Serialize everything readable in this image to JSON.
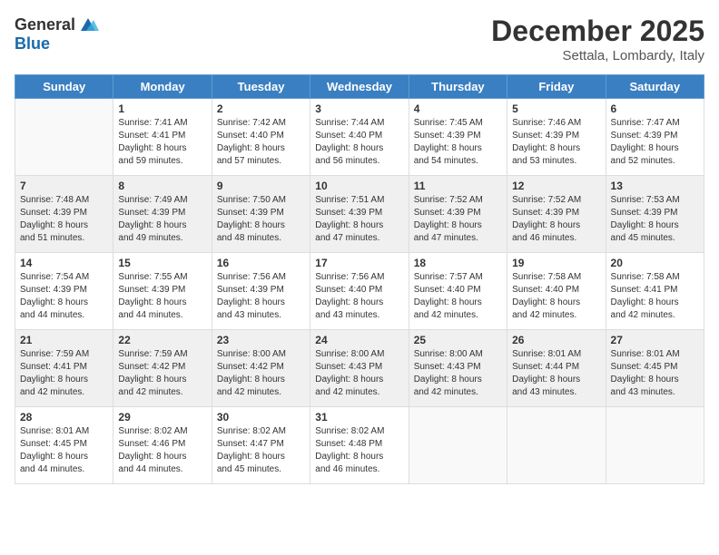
{
  "header": {
    "logo_general": "General",
    "logo_blue": "Blue",
    "month_title": "December 2025",
    "location": "Settala, Lombardy, Italy"
  },
  "weekdays": [
    "Sunday",
    "Monday",
    "Tuesday",
    "Wednesday",
    "Thursday",
    "Friday",
    "Saturday"
  ],
  "weeks": [
    [
      {
        "day": "",
        "info": ""
      },
      {
        "day": "1",
        "info": "Sunrise: 7:41 AM\nSunset: 4:41 PM\nDaylight: 8 hours\nand 59 minutes."
      },
      {
        "day": "2",
        "info": "Sunrise: 7:42 AM\nSunset: 4:40 PM\nDaylight: 8 hours\nand 57 minutes."
      },
      {
        "day": "3",
        "info": "Sunrise: 7:44 AM\nSunset: 4:40 PM\nDaylight: 8 hours\nand 56 minutes."
      },
      {
        "day": "4",
        "info": "Sunrise: 7:45 AM\nSunset: 4:39 PM\nDaylight: 8 hours\nand 54 minutes."
      },
      {
        "day": "5",
        "info": "Sunrise: 7:46 AM\nSunset: 4:39 PM\nDaylight: 8 hours\nand 53 minutes."
      },
      {
        "day": "6",
        "info": "Sunrise: 7:47 AM\nSunset: 4:39 PM\nDaylight: 8 hours\nand 52 minutes."
      }
    ],
    [
      {
        "day": "7",
        "info": "Sunrise: 7:48 AM\nSunset: 4:39 PM\nDaylight: 8 hours\nand 51 minutes."
      },
      {
        "day": "8",
        "info": "Sunrise: 7:49 AM\nSunset: 4:39 PM\nDaylight: 8 hours\nand 49 minutes."
      },
      {
        "day": "9",
        "info": "Sunrise: 7:50 AM\nSunset: 4:39 PM\nDaylight: 8 hours\nand 48 minutes."
      },
      {
        "day": "10",
        "info": "Sunrise: 7:51 AM\nSunset: 4:39 PM\nDaylight: 8 hours\nand 47 minutes."
      },
      {
        "day": "11",
        "info": "Sunrise: 7:52 AM\nSunset: 4:39 PM\nDaylight: 8 hours\nand 47 minutes."
      },
      {
        "day": "12",
        "info": "Sunrise: 7:52 AM\nSunset: 4:39 PM\nDaylight: 8 hours\nand 46 minutes."
      },
      {
        "day": "13",
        "info": "Sunrise: 7:53 AM\nSunset: 4:39 PM\nDaylight: 8 hours\nand 45 minutes."
      }
    ],
    [
      {
        "day": "14",
        "info": "Sunrise: 7:54 AM\nSunset: 4:39 PM\nDaylight: 8 hours\nand 44 minutes."
      },
      {
        "day": "15",
        "info": "Sunrise: 7:55 AM\nSunset: 4:39 PM\nDaylight: 8 hours\nand 44 minutes."
      },
      {
        "day": "16",
        "info": "Sunrise: 7:56 AM\nSunset: 4:39 PM\nDaylight: 8 hours\nand 43 minutes."
      },
      {
        "day": "17",
        "info": "Sunrise: 7:56 AM\nSunset: 4:40 PM\nDaylight: 8 hours\nand 43 minutes."
      },
      {
        "day": "18",
        "info": "Sunrise: 7:57 AM\nSunset: 4:40 PM\nDaylight: 8 hours\nand 42 minutes."
      },
      {
        "day": "19",
        "info": "Sunrise: 7:58 AM\nSunset: 4:40 PM\nDaylight: 8 hours\nand 42 minutes."
      },
      {
        "day": "20",
        "info": "Sunrise: 7:58 AM\nSunset: 4:41 PM\nDaylight: 8 hours\nand 42 minutes."
      }
    ],
    [
      {
        "day": "21",
        "info": "Sunrise: 7:59 AM\nSunset: 4:41 PM\nDaylight: 8 hours\nand 42 minutes."
      },
      {
        "day": "22",
        "info": "Sunrise: 7:59 AM\nSunset: 4:42 PM\nDaylight: 8 hours\nand 42 minutes."
      },
      {
        "day": "23",
        "info": "Sunrise: 8:00 AM\nSunset: 4:42 PM\nDaylight: 8 hours\nand 42 minutes."
      },
      {
        "day": "24",
        "info": "Sunrise: 8:00 AM\nSunset: 4:43 PM\nDaylight: 8 hours\nand 42 minutes."
      },
      {
        "day": "25",
        "info": "Sunrise: 8:00 AM\nSunset: 4:43 PM\nDaylight: 8 hours\nand 42 minutes."
      },
      {
        "day": "26",
        "info": "Sunrise: 8:01 AM\nSunset: 4:44 PM\nDaylight: 8 hours\nand 43 minutes."
      },
      {
        "day": "27",
        "info": "Sunrise: 8:01 AM\nSunset: 4:45 PM\nDaylight: 8 hours\nand 43 minutes."
      }
    ],
    [
      {
        "day": "28",
        "info": "Sunrise: 8:01 AM\nSunset: 4:45 PM\nDaylight: 8 hours\nand 44 minutes."
      },
      {
        "day": "29",
        "info": "Sunrise: 8:02 AM\nSunset: 4:46 PM\nDaylight: 8 hours\nand 44 minutes."
      },
      {
        "day": "30",
        "info": "Sunrise: 8:02 AM\nSunset: 4:47 PM\nDaylight: 8 hours\nand 45 minutes."
      },
      {
        "day": "31",
        "info": "Sunrise: 8:02 AM\nSunset: 4:48 PM\nDaylight: 8 hours\nand 46 minutes."
      },
      {
        "day": "",
        "info": ""
      },
      {
        "day": "",
        "info": ""
      },
      {
        "day": "",
        "info": ""
      }
    ]
  ]
}
